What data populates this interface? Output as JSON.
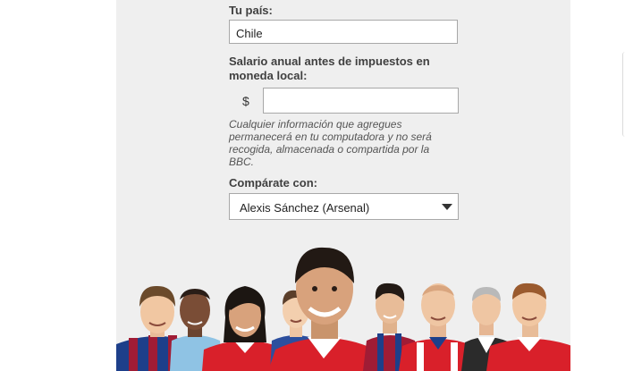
{
  "form": {
    "country_label": "Tu país:",
    "country_value": "Chile",
    "salary_label": "Salario anual antes de impuestos en moneda local:",
    "currency_symbol": "$",
    "salary_value": "",
    "privacy_note": "Cualquier información que agregues permanecerá en tu computadora y no será recogida, almacenada o compartida por la BBC.",
    "compare_label": "Compárate con:",
    "compare_selected": "Alexis Sánchez (Arsenal)"
  },
  "colors": {
    "panel_background": "#efefef",
    "field_border": "#a8a8a8",
    "label_text": "#404040",
    "arsenal_red": "#d9202a",
    "barcelona_blue": "#1d3f8a",
    "barcelona_garnet": "#a01c35"
  },
  "icons": {
    "dropdown": "caret-down-icon"
  }
}
